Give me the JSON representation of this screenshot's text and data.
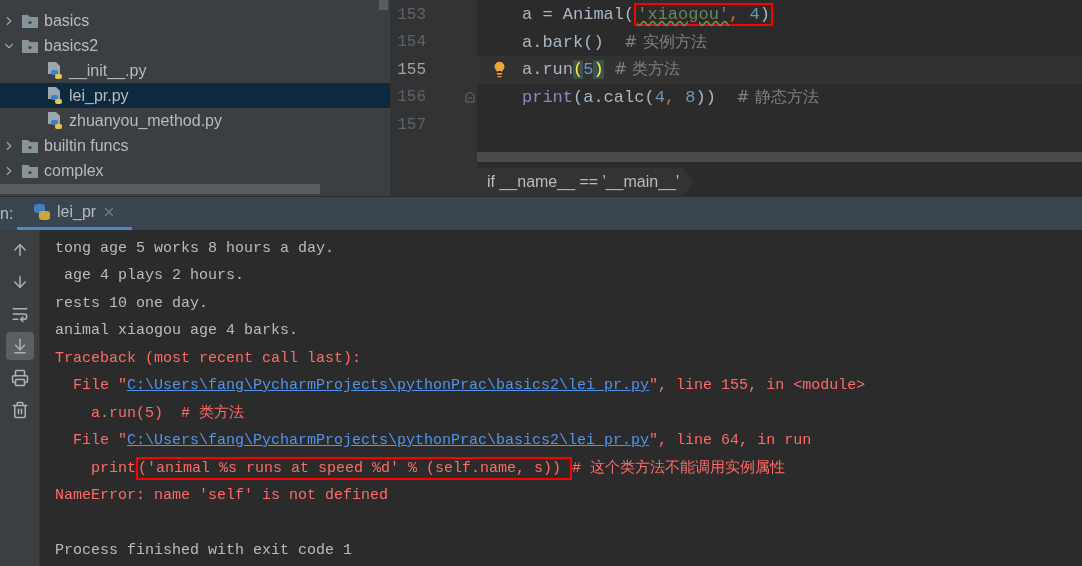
{
  "project_tree": [
    {
      "kind": "folder",
      "label": "basics",
      "expanded": false,
      "selected": false
    },
    {
      "kind": "folder",
      "label": "basics2",
      "expanded": true,
      "selected": false,
      "children": [
        {
          "kind": "python_file",
          "label": "__init__.py",
          "selected": false
        },
        {
          "kind": "python_file",
          "label": "lei_pr.py",
          "selected": true
        },
        {
          "kind": "python_file",
          "label": "zhuanyou_method.py",
          "selected": false
        }
      ]
    },
    {
      "kind": "folder",
      "label": "builtin funcs",
      "expanded": false,
      "selected": false
    },
    {
      "kind": "folder",
      "label": "complex",
      "expanded": false,
      "selected": false
    }
  ],
  "editor": {
    "lines": [
      {
        "number": "153",
        "current": false,
        "bulb": false,
        "fold_marker": false,
        "segments": [
          {
            "kind": "plain",
            "text": "a = Animal"
          },
          {
            "kind": "plain",
            "text": "("
          },
          {
            "kind": "boxed",
            "segments": [
              {
                "kind": "string_typo",
                "text": "'xiaogou'"
              },
              {
                "kind": "keyword",
                "text": ", "
              },
              {
                "kind": "number",
                "text": "4"
              },
              {
                "kind": "plain",
                "text": ")"
              }
            ]
          }
        ]
      },
      {
        "number": "154",
        "current": false,
        "bulb": false,
        "fold_marker": false,
        "segments": [
          {
            "kind": "plain",
            "text": "a.bark()  "
          },
          {
            "kind": "comment",
            "text": "# 实例方法"
          }
        ]
      },
      {
        "number": "155",
        "current": true,
        "bulb": true,
        "fold_marker": false,
        "segments": [
          {
            "kind": "plain",
            "text": "a.run"
          },
          {
            "kind": "paren_match",
            "text": "("
          },
          {
            "kind": "number",
            "text": "5"
          },
          {
            "kind": "paren_match",
            "text": ")"
          },
          {
            "kind": "comment",
            "text": "  # 类方法"
          }
        ]
      },
      {
        "number": "156",
        "current": false,
        "bulb": false,
        "fold_marker": true,
        "segments": [
          {
            "kind": "builtin",
            "text": "print"
          },
          {
            "kind": "plain",
            "text": "(a.calc("
          },
          {
            "kind": "number",
            "text": "4"
          },
          {
            "kind": "keyword",
            "text": ", "
          },
          {
            "kind": "number",
            "text": "8"
          },
          {
            "kind": "plain",
            "text": "))  "
          },
          {
            "kind": "comment",
            "text": "# 静态方法"
          }
        ]
      },
      {
        "number": "157",
        "current": false,
        "bulb": false,
        "fold_marker": false
      }
    ],
    "breadcrumb": "if __name__ == '__main__'"
  },
  "run_panel": {
    "label": "n:",
    "tabs": [
      {
        "label": "lei_pr",
        "selected": true
      }
    ],
    "toolbar": [
      {
        "kind": "up",
        "on": false
      },
      {
        "kind": "down",
        "on": false
      },
      {
        "kind": "wrap",
        "on": false
      },
      {
        "kind": "scroll_end",
        "on": true
      },
      {
        "kind": "print",
        "on": false
      },
      {
        "kind": "trash",
        "on": false
      }
    ],
    "console": [
      {
        "kind": "stdout",
        "segments": [
          {
            "kind": "text",
            "text": "tong age 5 works 8 hours a day."
          }
        ]
      },
      {
        "kind": "stdout",
        "segments": [
          {
            "kind": "text",
            "text": " age 4 plays 2 hours."
          }
        ]
      },
      {
        "kind": "stdout",
        "segments": [
          {
            "kind": "text",
            "text": "rests 10 one day."
          }
        ]
      },
      {
        "kind": "stdout",
        "segments": [
          {
            "kind": "text",
            "text": "animal xiaogou age 4 barks."
          }
        ]
      },
      {
        "kind": "stderr",
        "segments": [
          {
            "kind": "text",
            "text": "Traceback (most recent call last):"
          }
        ]
      },
      {
        "kind": "stderr",
        "segments": [
          {
            "kind": "text",
            "text": "  File \""
          },
          {
            "kind": "link",
            "text": "C:\\Users\\fang\\PycharmProjects\\pythonPrac\\basics2\\lei_pr.py"
          },
          {
            "kind": "text",
            "text": "\", line 155, in <module>"
          }
        ]
      },
      {
        "kind": "stderr",
        "segments": [
          {
            "kind": "text",
            "text": "    a.run(5)  # 类方法"
          }
        ]
      },
      {
        "kind": "stderr",
        "segments": [
          {
            "kind": "text",
            "text": "  File \""
          },
          {
            "kind": "link",
            "text": "C:\\Users\\fang\\PycharmProjects\\pythonPrac\\basics2\\lei_pr.py"
          },
          {
            "kind": "text",
            "text": "\", line 64, in run"
          }
        ]
      },
      {
        "kind": "stderr",
        "segments": [
          {
            "kind": "text",
            "text": "    print"
          },
          {
            "kind": "boxed",
            "text": "('animal %s runs at speed %d' % (self.name, s)) "
          },
          {
            "kind": "text",
            "text": "# 这个类方法不能调用实例属性"
          }
        ]
      },
      {
        "kind": "stderr",
        "segments": [
          {
            "kind": "text",
            "text": "NameError: name 'self' is not defined"
          }
        ]
      },
      {
        "kind": "blank"
      },
      {
        "kind": "stdout",
        "segments": [
          {
            "kind": "text",
            "text": "Process finished with exit code 1"
          }
        ]
      }
    ]
  }
}
